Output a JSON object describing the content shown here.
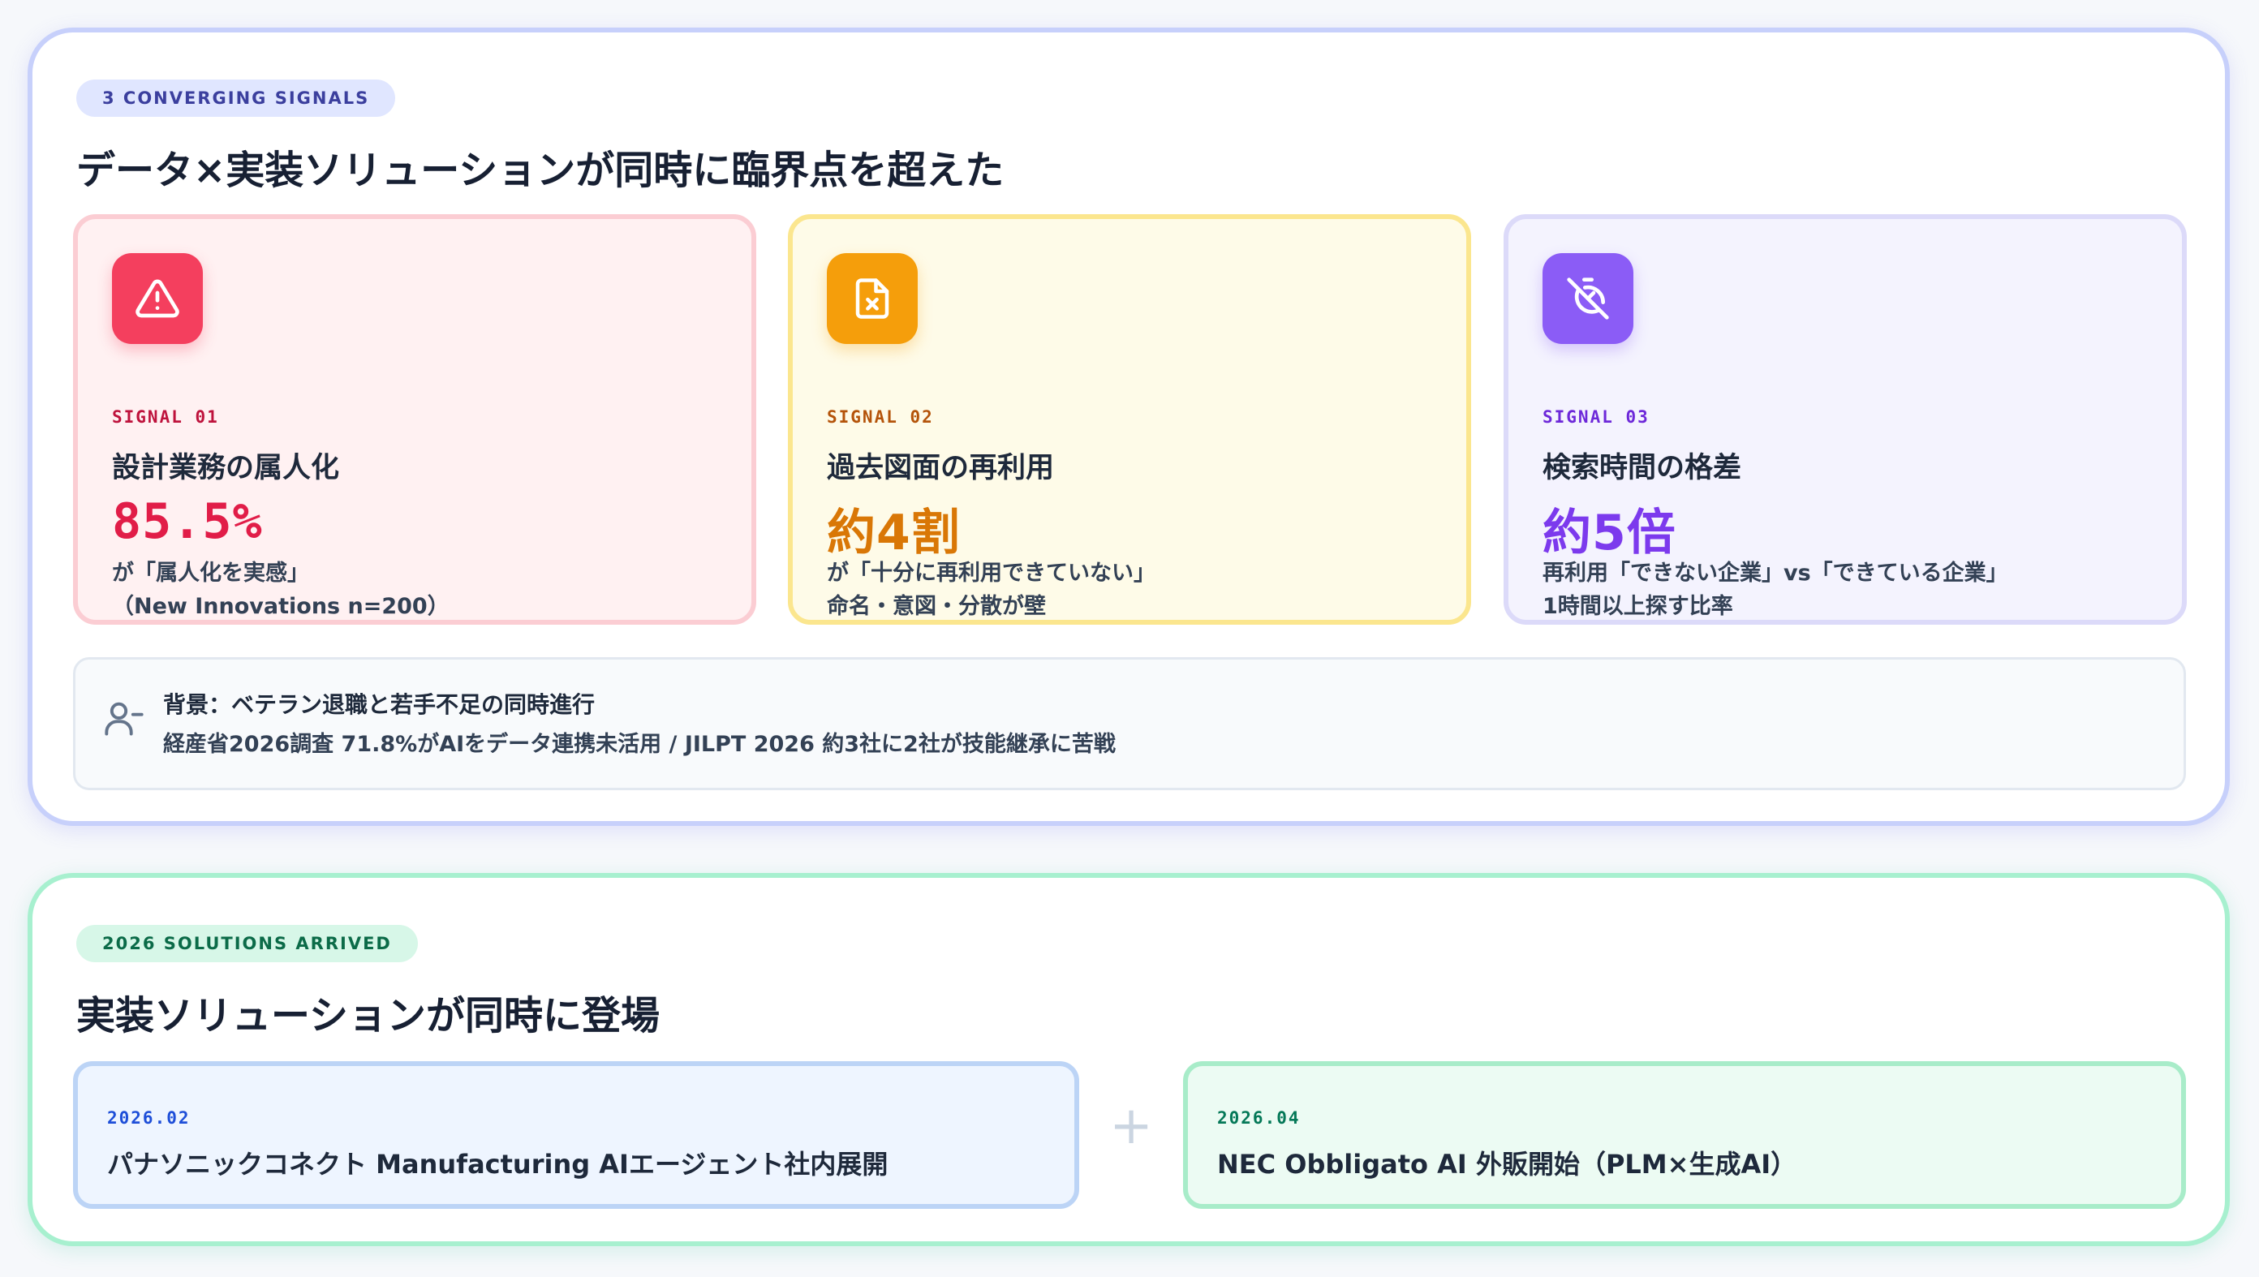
{
  "signals_section": {
    "badge": "3 CONVERGING SIGNALS",
    "heading": "データ×実装ソリューションが同時に臨界点を超えた",
    "cards": [
      {
        "label": "SIGNAL 01",
        "title": "設計業務の属人化",
        "value": "85.5%",
        "desc_line1": "が「属人化を実感」",
        "desc_line2": "（New Innovations n=200）",
        "icon": "alert-triangle-icon",
        "color": "#e11d48"
      },
      {
        "label": "SIGNAL 02",
        "title": "過去図面の再利用",
        "value": "約4割",
        "desc_line1": "が「十分に再利用できていない」",
        "desc_line2": "命名・意図・分散が壁",
        "icon": "file-x-icon",
        "color": "#d97706"
      },
      {
        "label": "SIGNAL 03",
        "title": "検索時間の格差",
        "value": "約5倍",
        "desc_line1": "再利用「できない企業」vs「できている企業」",
        "desc_line2": "1時間以上探す比率",
        "icon": "timer-off-icon",
        "color": "#7c3aed"
      }
    ],
    "background": {
      "title": "背景：ベテラン退職と若手不足の同時進行",
      "detail": "経産省2026調査 71.8%がAIをデータ連携未活用 / JILPT 2026 約3社に2社が技能継承に苦戦",
      "icon": "user-minus-icon"
    }
  },
  "solutions_section": {
    "badge": "2026 SOLUTIONS ARRIVED",
    "heading": "実装ソリューションが同時に登場",
    "items": [
      {
        "date": "2026.02",
        "name": "パナソニックコネクト Manufacturing AIエージェント社内展開"
      },
      {
        "date": "2026.04",
        "name": "NEC Obbligato AI 外販開始（PLM×生成AI）"
      }
    ],
    "connector": "+"
  }
}
